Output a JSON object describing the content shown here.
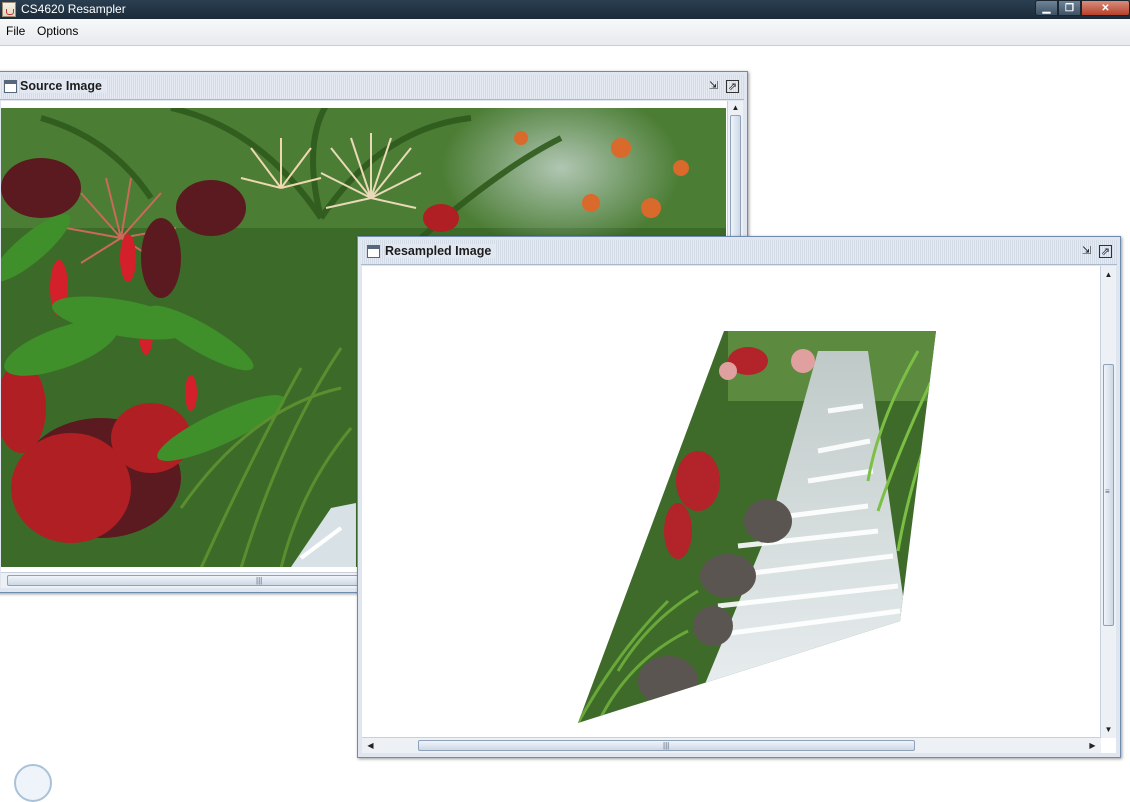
{
  "app": {
    "title": "CS4620 Resampler",
    "icon": "java-cup-icon"
  },
  "window_buttons": {
    "minimize": "minimize-icon",
    "maximize": "maximize-icon",
    "close": "close-icon"
  },
  "menu": {
    "items": [
      "File",
      "Options"
    ]
  },
  "source_frame": {
    "title": "Source Image",
    "icon": "frame-icon",
    "image": "tropical-garden-photo"
  },
  "resampled_frame": {
    "title": "Resampled Image",
    "icon": "frame-icon",
    "image": "warped-waterfall-photo",
    "vertical_scroll_position": 0.22,
    "horizontal_scroll_position": 0.1
  },
  "colors": {
    "titlebar": "#1b2a38",
    "frame_border": "#6f8bb0",
    "close_button": "#c4503a"
  }
}
